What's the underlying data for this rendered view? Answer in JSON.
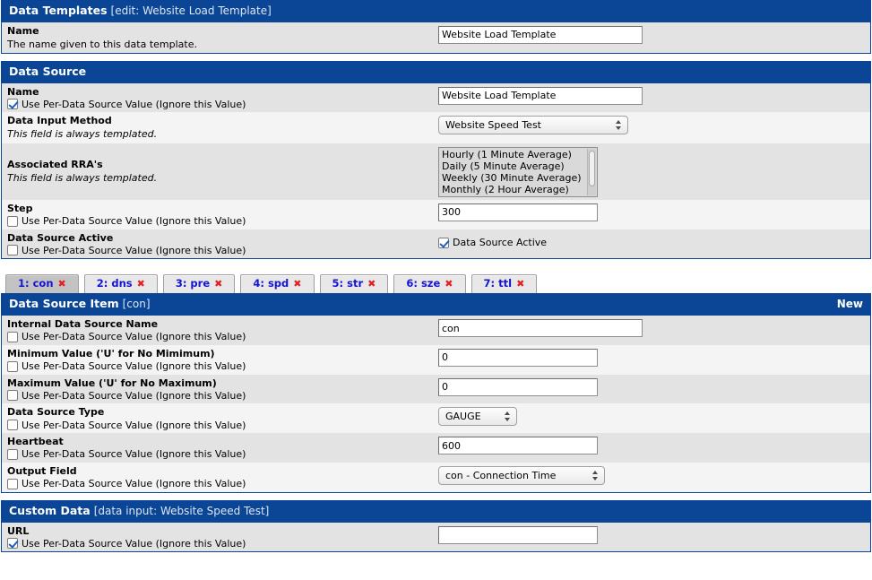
{
  "common": {
    "per_ds_label": "Use Per-Data Source Value (Ignore this Value)",
    "always_templated": "This field is always templated."
  },
  "colors": {
    "header_blue": "#0a4596",
    "row_dark": "#e3e3e3",
    "row_light": "#f4f4f4",
    "tab_link": "#1414d2",
    "tab_close": "#e02121",
    "active_tab_bg": "#c3c3c3"
  },
  "data_templates": {
    "header_title": "Data Templates",
    "header_sub": "[edit: Website Load Template]",
    "name_row": {
      "title": "Name",
      "desc": "The name given to this data template.",
      "value": "Website Load Template"
    }
  },
  "data_source": {
    "header_title": "Data Source",
    "rows": {
      "name": {
        "title": "Name",
        "checkbox_label": "Use Per-Data Source Value (Ignore this Value)",
        "checked": true,
        "value": "Website Load Template"
      },
      "data_input_method": {
        "title": "Data Input Method",
        "desc": "This field is always templated.",
        "selected": "Website Speed Test"
      },
      "associated_rras": {
        "title": "Associated RRA's",
        "desc": "This field is always templated.",
        "options": [
          "Hourly (1 Minute Average)",
          "Daily (5 Minute Average)",
          "Weekly (30 Minute Average)",
          "Monthly (2 Hour Average)"
        ]
      },
      "step": {
        "title": "Step",
        "checkbox_label": "Use Per-Data Source Value (Ignore this Value)",
        "checked": false,
        "value": "300"
      },
      "data_source_active": {
        "title": "Data Source Active",
        "checkbox_label": "Use Per-Data Source Value (Ignore this Value)",
        "checked": false,
        "active_label": "Data Source Active",
        "active_checked": true
      }
    }
  },
  "tabs": [
    {
      "label": "1: con",
      "close": "✖",
      "active": true
    },
    {
      "label": "2: dns",
      "close": "✖",
      "active": false
    },
    {
      "label": "3: pre",
      "close": "✖",
      "active": false
    },
    {
      "label": "4: spd",
      "close": "✖",
      "active": false
    },
    {
      "label": "5: str",
      "close": "✖",
      "active": false
    },
    {
      "label": "6: sze",
      "close": "✖",
      "active": false
    },
    {
      "label": "7: ttl",
      "close": "✖",
      "active": false
    }
  ],
  "data_source_item": {
    "header_title": "Data Source Item",
    "header_sub": "[con]",
    "header_action": "New",
    "rows": {
      "internal_name": {
        "title": "Internal Data Source Name",
        "checkbox_label": "Use Per-Data Source Value (Ignore this Value)",
        "checked": false,
        "value": "con"
      },
      "minimum_value": {
        "title": "Minimum Value ('U' for No Mimimum)",
        "checkbox_label": "Use Per-Data Source Value (Ignore this Value)",
        "checked": false,
        "value": "0"
      },
      "maximum_value": {
        "title": "Maximum Value ('U' for No Maximum)",
        "checkbox_label": "Use Per-Data Source Value (Ignore this Value)",
        "checked": false,
        "value": "0"
      },
      "data_source_type": {
        "title": "Data Source Type",
        "checkbox_label": "Use Per-Data Source Value (Ignore this Value)",
        "checked": false,
        "selected": "GAUGE"
      },
      "heartbeat": {
        "title": "Heartbeat",
        "checkbox_label": "Use Per-Data Source Value (Ignore this Value)",
        "checked": false,
        "value": "600"
      },
      "output_field": {
        "title": "Output Field",
        "checkbox_label": "Use Per-Data Source Value (Ignore this Value)",
        "checked": false,
        "selected": "con - Connection Time"
      }
    }
  },
  "custom_data": {
    "header_title": "Custom Data",
    "header_sub": "[data input: Website Speed Test]",
    "rows": {
      "url": {
        "title": "URL",
        "checkbox_label": "Use Per-Data Source Value (Ignore this Value)",
        "checked": true,
        "value": ""
      }
    }
  }
}
